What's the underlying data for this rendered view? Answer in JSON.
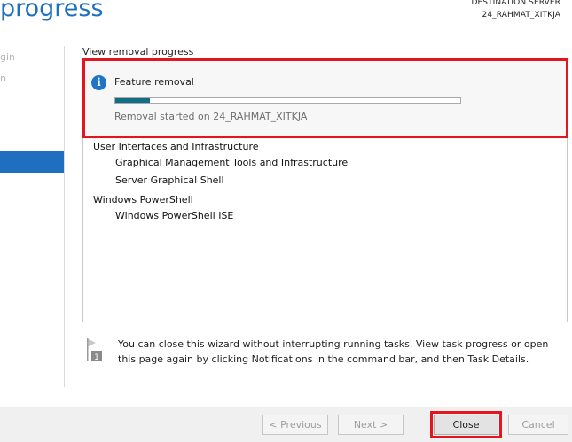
{
  "header": {
    "title": "progress",
    "destination_label": "DESTINATION SERVER",
    "destination_server": "24_RAHMAT_XITKJA"
  },
  "sidebar": {
    "items": [
      {
        "label": "gin"
      },
      {
        "label": "n"
      }
    ]
  },
  "main": {
    "section_label": "View removal progress",
    "progress": {
      "title": "Feature removal",
      "status": "Removal started on 24_RAHMAT_XITKJA",
      "fraction": 0.1
    },
    "features": [
      {
        "label": "User Interfaces and Infrastructure",
        "level": "group"
      },
      {
        "label": "Graphical Management Tools and Infrastructure",
        "level": "child"
      },
      {
        "label": "Server Graphical Shell",
        "level": "child"
      },
      {
        "label": "Windows PowerShell",
        "level": "group"
      },
      {
        "label": "Windows PowerShell ISE",
        "level": "child"
      }
    ],
    "notice": "You can close this wizard without interrupting running tasks. View task progress or open this page again by clicking Notifications in the command bar, and then Task Details."
  },
  "footer": {
    "previous_label": "< Previous",
    "next_label": "Next >",
    "close_label": "Close",
    "cancel_label": "Cancel"
  },
  "colors": {
    "accent": "#1e6fc0",
    "progress_fill": "#106f84",
    "highlight": "#e3161f"
  },
  "icons": {
    "info": "info-icon",
    "notice": "flag-notice-icon"
  }
}
